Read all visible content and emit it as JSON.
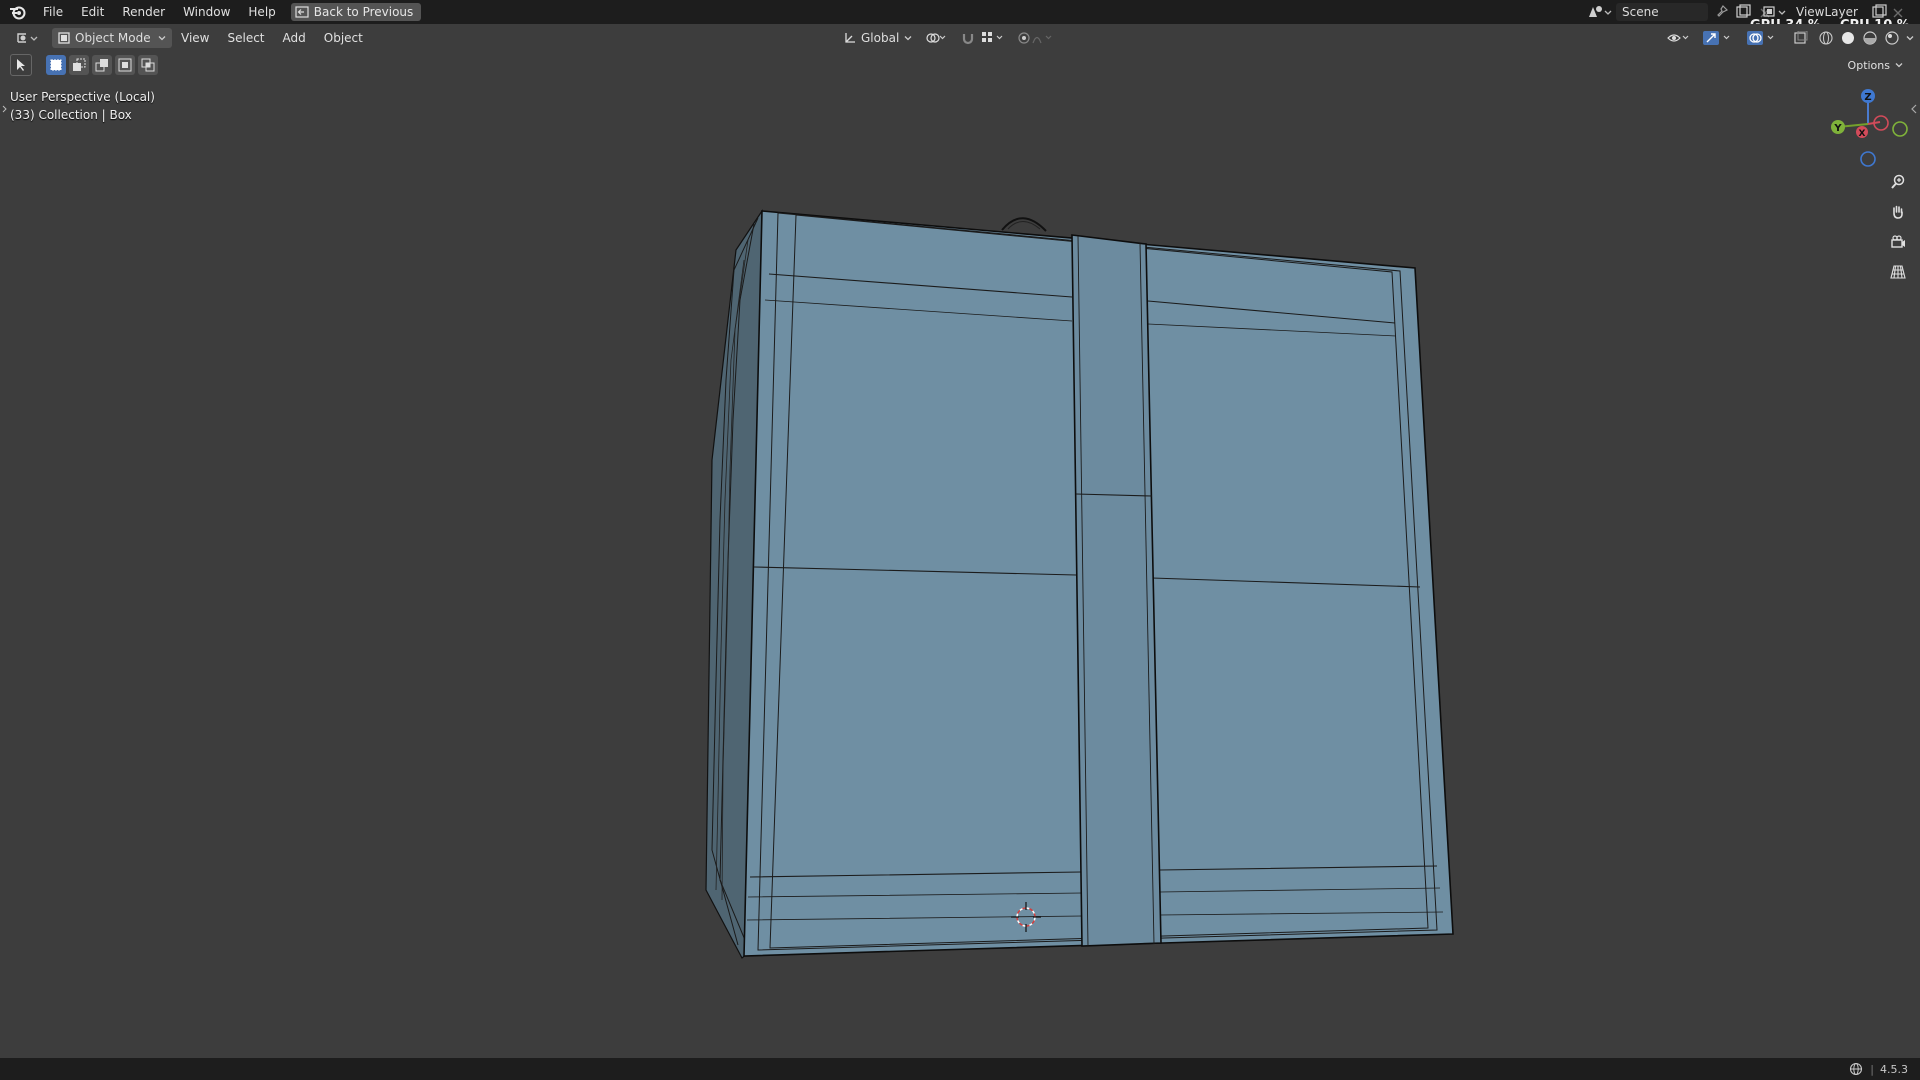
{
  "topbar": {
    "menus": [
      "File",
      "Edit",
      "Render",
      "Window",
      "Help"
    ],
    "back_button": "Back to Previous",
    "scene_name": "Scene",
    "view_layer_name": "ViewLayer",
    "gpu": "GPU 34 %",
    "cpu": "CPU 10 %"
  },
  "header": {
    "mode": "Object Mode",
    "menus": [
      "View",
      "Select",
      "Add",
      "Object"
    ],
    "transform_orientation": "Global",
    "options": "Options"
  },
  "viewport": {
    "view_name": "User Perspective (Local)",
    "collection": "(33) Collection | Box",
    "object_color": "#6f8fa3",
    "gizmo": {
      "x": "X",
      "y": "Y",
      "z": "Z"
    }
  },
  "statusbar": {
    "version": "4.5.3"
  }
}
